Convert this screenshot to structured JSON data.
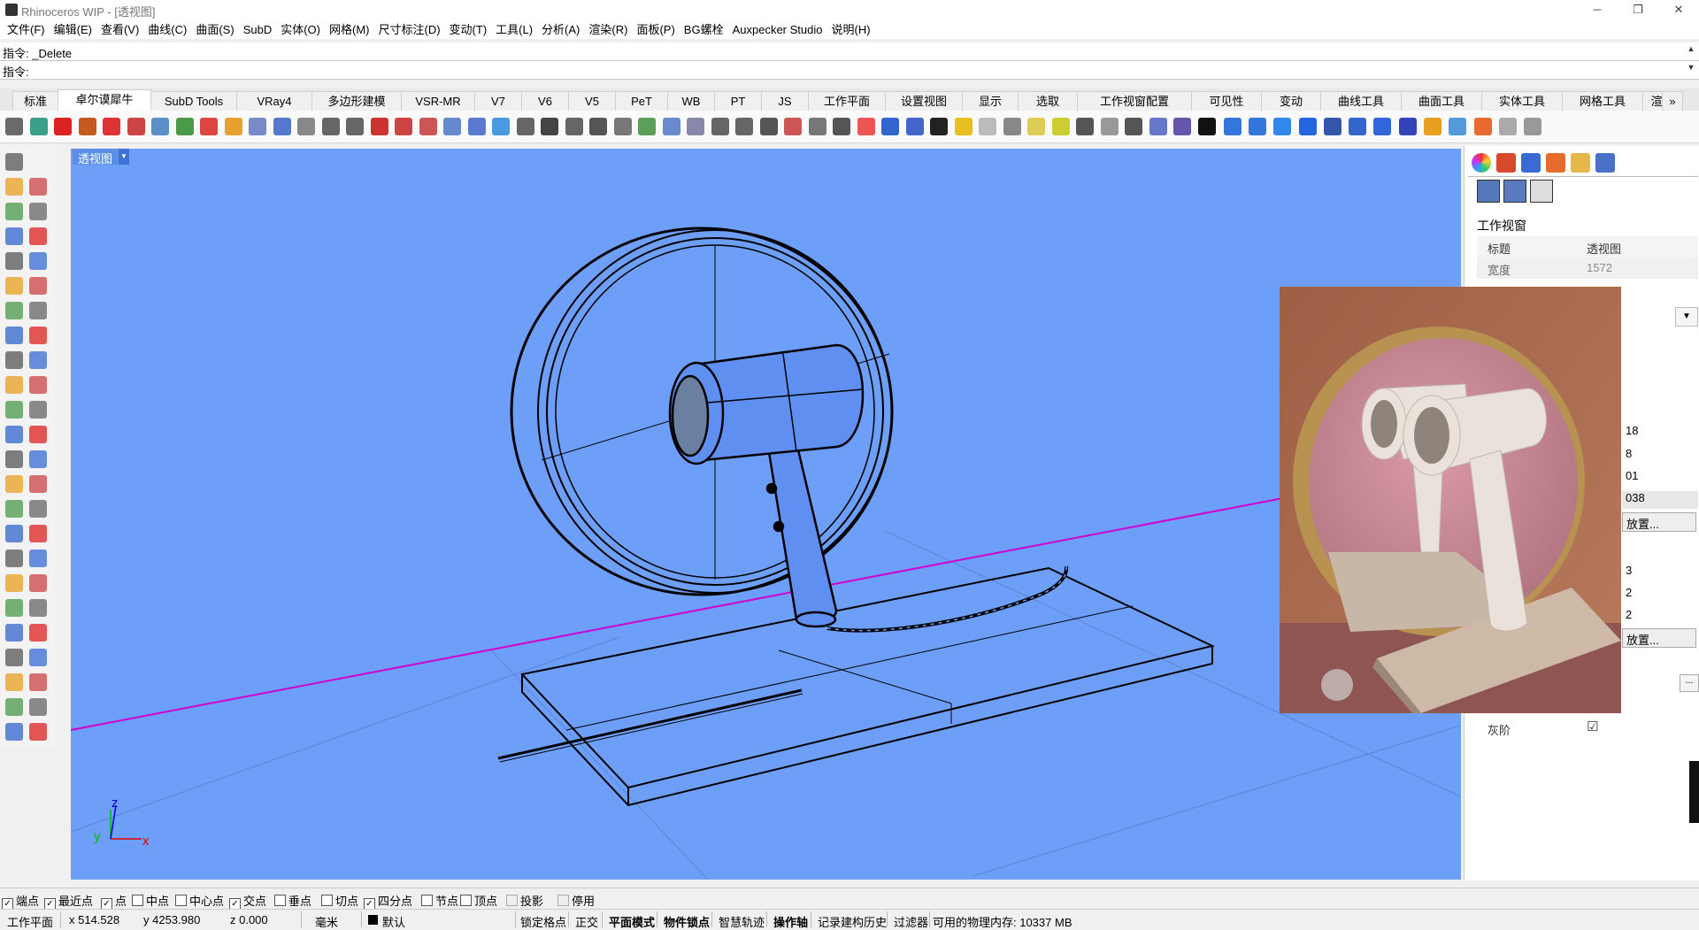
{
  "window": {
    "title": "Rhinoceros WIP - [透视图]"
  },
  "menu": [
    "文件(F)",
    "编辑(E)",
    "查看(V)",
    "曲线(C)",
    "曲面(S)",
    "SubD",
    "实体(O)",
    "网格(M)",
    "尺寸标注(D)",
    "变动(T)",
    "工具(L)",
    "分析(A)",
    "渲染(R)",
    "面板(P)",
    "BG螺栓",
    "Auxpecker Studio",
    "说明(H)"
  ],
  "command": {
    "history": "指令: _Delete",
    "prompt": "指令:"
  },
  "tabs": [
    "标准",
    "卓尔谟犀牛",
    "SubD Tools",
    "VRay4",
    "多边形建模",
    "VSR-MR",
    "V7",
    "V6",
    "V5",
    "PeT",
    "WB",
    "PT",
    "JS",
    "工作平面",
    "设置视图",
    "显示",
    "选取",
    "工作视窗配置",
    "可见性",
    "变动",
    "曲线工具",
    "曲面工具",
    "实体工具",
    "网格工具",
    "渲"
  ],
  "tabs_active": "卓尔谟犀牛",
  "tabs_more": "»",
  "viewport": {
    "label": "透视图",
    "axis_x": "x",
    "axis_y": "y",
    "axis_z": "z"
  },
  "panel": {
    "section_title": "工作视窗",
    "rows": [
      {
        "key": "标题",
        "value": "透视图"
      },
      {
        "key": "宽度",
        "value": "1572"
      }
    ],
    "partial_values": [
      "18",
      "8",
      "01",
      "038",
      "放置...",
      "3",
      "2",
      "2",
      "放置...",
      "..."
    ],
    "grayscale_label": "灰阶",
    "grayscale_checked": "☑"
  },
  "osnap": [
    {
      "label": "端点",
      "checked": true
    },
    {
      "label": "最近点",
      "checked": true
    },
    {
      "label": "点",
      "checked": true
    },
    {
      "label": "中点",
      "checked": false
    },
    {
      "label": "中心点",
      "checked": false
    },
    {
      "label": "交点",
      "checked": true
    },
    {
      "label": "垂点",
      "checked": false
    },
    {
      "label": "切点",
      "checked": false
    },
    {
      "label": "四分点",
      "checked": true
    },
    {
      "label": "节点",
      "checked": false
    },
    {
      "label": "顶点",
      "checked": false
    },
    {
      "label": "投影",
      "checked": false
    },
    {
      "label": "停用",
      "checked": false
    }
  ],
  "status": {
    "cplane": "工作平面",
    "x": "x 514.528",
    "y": "y 4253.980",
    "z": "z 0.000",
    "units": "毫米",
    "layer": "默认",
    "grid_snap": "锁定格点",
    "ortho": "正交",
    "planar": "平面模式",
    "osnap": "物件锁点",
    "smarttrack": "智慧轨迹",
    "gumball": "操作轴",
    "history": "记录建构历史",
    "filter": "过滤器",
    "memory": "可用的物理内存: 10337 MB"
  }
}
